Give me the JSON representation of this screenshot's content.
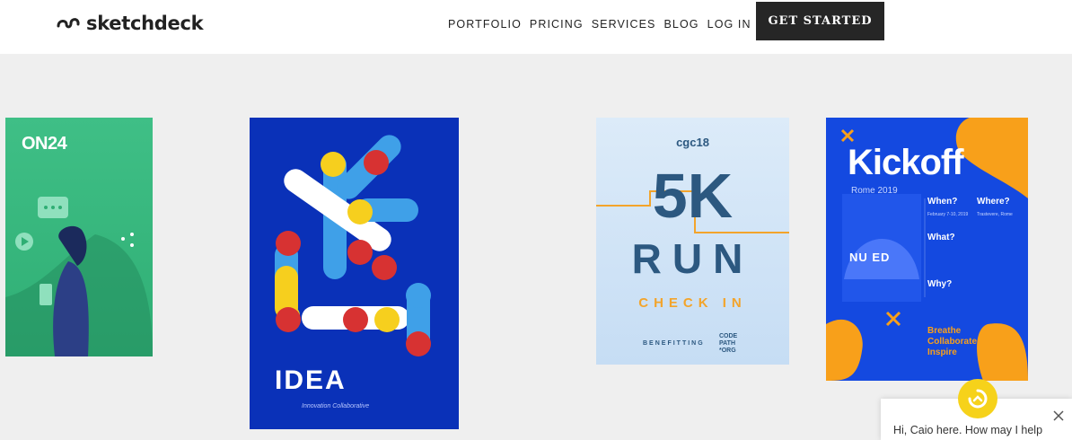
{
  "brand": {
    "name": "sketchdeck"
  },
  "nav": {
    "items": [
      {
        "label": "PORTFOLIO"
      },
      {
        "label": "PRICING"
      },
      {
        "label": "SERVICES"
      },
      {
        "label": "BLOG"
      },
      {
        "label": "LOG IN"
      }
    ],
    "cta_label": "GET STARTED"
  },
  "portfolio": {
    "card1": {
      "logo": "ON24"
    },
    "card2": {
      "title": "IDEA",
      "subtitle": "Innovation Collaborative"
    },
    "card3": {
      "eyebrow": "cgc18",
      "big1": "5K",
      "big2": "RUN",
      "checkin": "CHECK IN",
      "benefitting": "BENEFITTING",
      "org_lines": [
        "CODE",
        "PATH",
        "*ORG"
      ]
    },
    "card4": {
      "title": "Kickoff",
      "subtitle": "Rome 2019",
      "when_label": "When?",
      "when_value": "February 7-10, 2019",
      "where_label": "Where?",
      "where_value": "Trastevere, Rome",
      "what_label": "What?",
      "why_label": "Why?",
      "bottom_lines": [
        "Breathe",
        "Collaborate",
        "Inspire"
      ],
      "badge": "NU ED"
    }
  },
  "chat": {
    "message": "Hi, Caio here. How may I help",
    "accent": "#f6d21a"
  },
  "colors": {
    "header_bg": "#ffffff",
    "page_bg": "#efefef",
    "cta_bg": "#262626"
  }
}
